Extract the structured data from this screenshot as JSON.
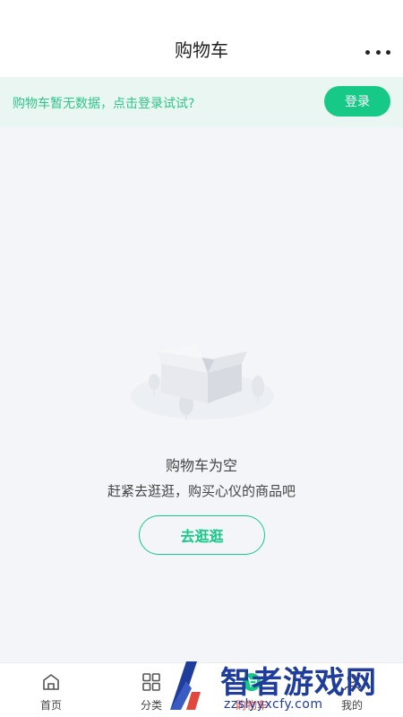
{
  "header": {
    "title": "购物车"
  },
  "login_bar": {
    "tip": "购物车暂无数据，点击登录试试?",
    "button_label": "登录"
  },
  "empty_state": {
    "title": "购物车为空",
    "subtitle": "赶紧去逛逛，购买心仪的商品吧",
    "button_label": "去逛逛"
  },
  "tabbar": {
    "items": [
      {
        "label": "首页",
        "icon": "home-icon"
      },
      {
        "label": "分类",
        "icon": "grid-icon"
      },
      {
        "label": "购物车",
        "icon": "cart-icon",
        "active": true
      },
      {
        "label": "我的",
        "icon": "user-icon"
      }
    ]
  },
  "watermark": {
    "title": "智者游戏网",
    "url": "zzslyyxcfy.com"
  },
  "colors": {
    "accent": "#16c986",
    "tip_text": "#2fc58c",
    "tip_bg": "#e9f6f1",
    "page_bg": "#f3f5f8",
    "active_tab": "#e0483e"
  }
}
